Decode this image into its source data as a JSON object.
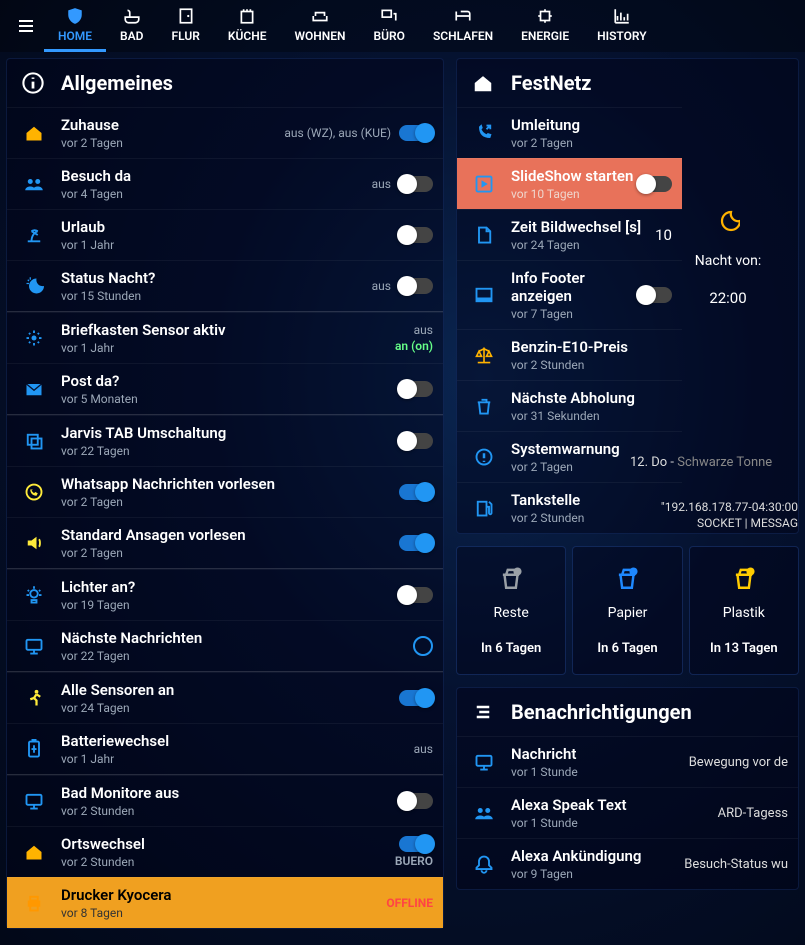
{
  "nav": {
    "tabs": [
      {
        "label": "HOME",
        "icon": "shield"
      },
      {
        "label": "BAD",
        "icon": "bath"
      },
      {
        "label": "FLUR",
        "icon": "door"
      },
      {
        "label": "KÜCHE",
        "icon": "kitchen"
      },
      {
        "label": "WOHNEN",
        "icon": "sofa"
      },
      {
        "label": "BÜRO",
        "icon": "desk"
      },
      {
        "label": "SCHLAFEN",
        "icon": "bed"
      },
      {
        "label": "ENERGIE",
        "icon": "energy"
      },
      {
        "label": "HISTORY",
        "icon": "chart"
      }
    ],
    "active_index": 0
  },
  "allgemeines": {
    "title": "Allgemeines",
    "rows": [
      {
        "key": "zuhause",
        "icon": "house",
        "color": "#ffb300",
        "title": "Zuhause",
        "sub": "vor 2 Tagen",
        "right_label": "aus (WZ), aus (KUE)",
        "toggle": true,
        "on": true
      },
      {
        "key": "besuch",
        "icon": "group",
        "color": "#2196f3",
        "title": "Besuch da",
        "sub": "vor 4 Tagen",
        "right_label": "aus",
        "toggle": true,
        "on": false
      },
      {
        "key": "urlaub",
        "icon": "beach",
        "color": "#2196f3",
        "title": "Urlaub",
        "sub": "vor 1 Jahr",
        "toggle": true,
        "on": false
      },
      {
        "key": "nacht",
        "icon": "night",
        "color": "#2196f3",
        "title": "Status Nacht?",
        "sub": "vor 15 Stunden",
        "right_label": "aus",
        "toggle": true,
        "on": false
      },
      {
        "sep": true
      },
      {
        "key": "briefkasten",
        "icon": "sensor",
        "color": "#2196f3",
        "title": "Briefkasten Sensor aktiv",
        "sub": "vor 1 Jahr",
        "right_label": "aus",
        "right_label2": "an (on)",
        "right_label2_class": "val-green"
      },
      {
        "key": "post",
        "icon": "mail",
        "color": "#2196f3",
        "title": "Post da?",
        "sub": "vor 5 Monaten",
        "toggle": true,
        "on": false
      },
      {
        "sep": true
      },
      {
        "key": "jarvis",
        "icon": "copy",
        "color": "#2196f3",
        "title": "Jarvis TAB Umschaltung",
        "sub": "vor 22 Tagen",
        "toggle": true,
        "on": false
      },
      {
        "key": "whatsapp",
        "icon": "whatsapp",
        "color": "#ffeb3b",
        "title": "Whatsapp Nachrichten vorlesen",
        "sub": "vor 2 Tagen",
        "toggle": true,
        "on": true
      },
      {
        "key": "ansagen",
        "icon": "speak",
        "color": "#ffeb3b",
        "title": "Standard Ansagen vorlesen",
        "sub": "vor 2 Tagen",
        "toggle": true,
        "on": true
      },
      {
        "sep": true
      },
      {
        "key": "lichter",
        "icon": "light",
        "color": "#2196f3",
        "title": "Lichter an?",
        "sub": "vor 19 Tagen",
        "toggle": true,
        "on": false
      },
      {
        "key": "nachrichten",
        "icon": "monitor",
        "color": "#2196f3",
        "title": "Nächste Nachrichten",
        "sub": "vor 22 Tagen",
        "circle": true
      },
      {
        "sep": true
      },
      {
        "key": "sensoren",
        "icon": "run",
        "color": "#ffeb3b",
        "title": "Alle Sensoren an",
        "sub": "vor 24 Tagen",
        "toggle": true,
        "on": true
      },
      {
        "key": "batterie",
        "icon": "battery",
        "color": "#2196f3",
        "title": "Batteriewechsel",
        "sub": "vor 1 Jahr",
        "right_label": "aus"
      },
      {
        "sep": true
      },
      {
        "key": "badmon",
        "icon": "monitor",
        "color": "#2196f3",
        "title": "Bad Monitore aus",
        "sub": "vor 2 Stunden",
        "toggle": true,
        "on": false
      },
      {
        "key": "ort",
        "icon": "house",
        "color": "#ffb300",
        "title": "Ortswechsel",
        "sub": "vor 2 Stunden",
        "toggle": true,
        "on": true,
        "right_label2": "BUERO"
      },
      {
        "key": "drucker",
        "icon": "printer",
        "color": "#ff9800",
        "title": "Drucker Kyocera",
        "sub": "vor 8 Tagen",
        "right_label": "OFFLINE",
        "right_label_class": "val-red",
        "highlight": "orange"
      }
    ]
  },
  "festnetz": {
    "title": "FestNetz",
    "night_label": "Nacht von:",
    "night_value": "22:00",
    "rows": [
      {
        "key": "umleitung",
        "icon": "callfwd",
        "color": "#2196f3",
        "title": "Umleitung",
        "sub": "vor 2 Tagen"
      },
      {
        "key": "slideshow",
        "icon": "play",
        "color": "#2196f3",
        "title": "SlideShow starten",
        "sub": "vor 10 Tagen",
        "toggle": true,
        "on": false,
        "highlight": "coral"
      },
      {
        "key": "bildwechsel",
        "icon": "doc",
        "color": "#2196f3",
        "title": "Zeit Bildwechsel [s]",
        "sub": "vor 24 Tagen",
        "value": "10"
      },
      {
        "key": "footer",
        "icon": "footer",
        "color": "#2196f3",
        "title": "Info Footer anzeigen",
        "sub": "vor 7 Tagen",
        "toggle": true,
        "on": false
      },
      {
        "key": "benzin",
        "icon": "scale",
        "color": "#ffb300",
        "title": "Benzin-E10-Preis",
        "sub": "vor 2 Stunden"
      },
      {
        "key": "abholung",
        "icon": "trash",
        "color": "#2196f3",
        "title": "Nächste Abholung",
        "sub": "vor 31 Sekunden",
        "rtext": "12. Do - ",
        "rtext_gray": "Schwarze Tonne"
      },
      {
        "key": "syswarn",
        "icon": "alert",
        "color": "#2196f3",
        "title": "Systemwarnung",
        "sub": "vor 2 Tagen",
        "rtext": "\"192.168.178.77-04:30:00 SOCKET | MESSAG"
      },
      {
        "key": "tankstelle",
        "icon": "fuel",
        "color": "#2196f3",
        "title": "Tankstelle",
        "sub": "vor 2 Stunden"
      }
    ]
  },
  "bins": [
    {
      "name": "Reste",
      "due": "In 6 Tagen",
      "color": "#9aa0a6"
    },
    {
      "name": "Papier",
      "due": "In 6 Tagen",
      "color": "#1e88ff"
    },
    {
      "name": "Plastik",
      "due": "In 13 Tagen",
      "color": "#ffcc00"
    }
  ],
  "notif": {
    "title": "Benachrichtigungen",
    "rows": [
      {
        "key": "nachricht",
        "icon": "monitor",
        "color": "#2196f3",
        "title": "Nachricht",
        "sub": "vor 1 Stunde",
        "rtext": "Bewegung vor de"
      },
      {
        "key": "alexaspeak",
        "icon": "group",
        "color": "#2196f3",
        "title": "Alexa Speak Text",
        "sub": "vor 1 Stunde",
        "rtext": "ARD-Tagess"
      },
      {
        "key": "alexaank",
        "icon": "bell",
        "color": "#2196f3",
        "title": "Alexa Ankündigung",
        "sub": "vor 9 Tagen",
        "rtext": "Besuch-Status wu"
      }
    ]
  }
}
